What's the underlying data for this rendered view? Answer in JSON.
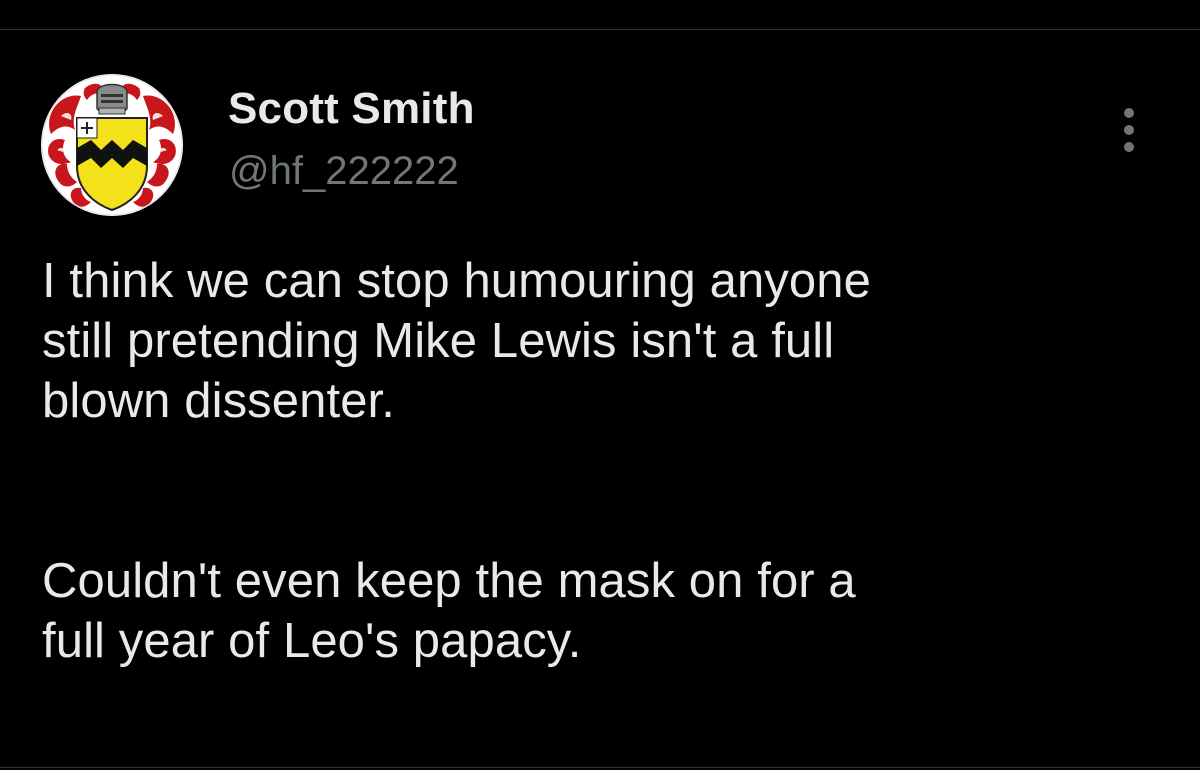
{
  "author": {
    "display_name": "Scott Smith",
    "handle": "@hf_222222",
    "avatar_icon": "coat-of-arms-icon"
  },
  "tweet": {
    "paragraphs": [
      "I think we can stop humouring anyone\nstill pretending Mike Lewis isn't a full\nblown dissenter.",
      "Couldn't even keep the mask on for a\nfull year of Leo's papacy."
    ]
  },
  "menu": {
    "more_icon": "more-vertical-icon"
  },
  "colors": {
    "background": "#000000",
    "text_primary": "#e7e9ea",
    "text_secondary": "#71767b",
    "divider": "#2f3336"
  }
}
